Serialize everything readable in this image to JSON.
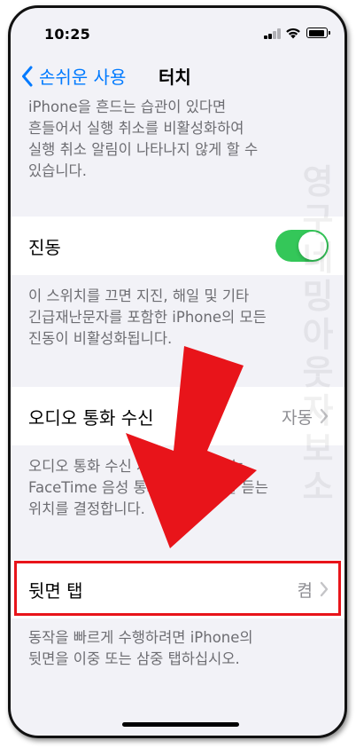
{
  "status_bar": {
    "time": "10:25"
  },
  "nav": {
    "back_label": "손쉬운 사용",
    "title": "터치"
  },
  "shake_footer": [
    "iPhone을 흔드는 습관이 있다면",
    "흔들어서 실행 취소를 비활성화하여",
    "실행 취소 알림이 나타나지 않게 할 수",
    "있습니다."
  ],
  "vibration": {
    "label": "진동",
    "toggle_on": true,
    "on_color": "#34c759"
  },
  "vibration_footer": [
    "이 스위치를 끄면 지진, 해일 및 기타",
    "긴급재난문자를 포함한 iPhone의 모든",
    "진동이 비활성화됩니다."
  ],
  "audio_routing": {
    "label": "오디오 통화 수신",
    "value": "자동"
  },
  "audio_footer": [
    "오디오 통화 수신 시 들을 위치 또는",
    "FaceTime 음성 통화 중 오디오를 듣는",
    "위치를 결정합니다."
  ],
  "back_tap": {
    "label": "뒷면 탭",
    "value": "켬"
  },
  "back_tap_footer": [
    "동작을 빠르게 수행하려면 iPhone의",
    "뒷면을 이중 또는 삼중 탭하십시오."
  ],
  "watermark": "영구네밍아웃자보소",
  "colors": {
    "accent": "#007aff",
    "highlight": "#e8141a",
    "arrow": "#e8141a"
  }
}
